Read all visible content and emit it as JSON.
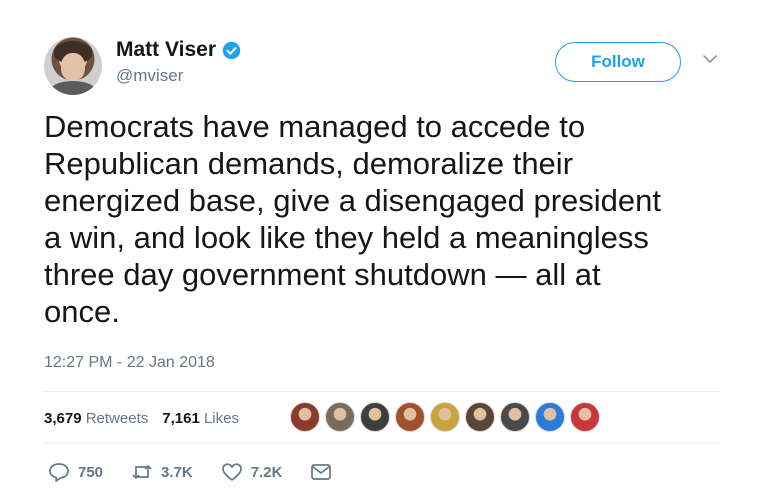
{
  "tweet": {
    "display_name": "Matt Viser",
    "handle": "@mviser",
    "follow_label": "Follow",
    "text": "Democrats have managed to accede to\nRepublican demands, demoralize their\nenergized base, give a disengaged president\na win, and look like they held a meaningless\nthree day government shutdown — all at\nonce.",
    "timestamp": "12:27 PM - 22 Jan 2018"
  },
  "stats": {
    "retweets_count": "3,679",
    "retweets_label": "Retweets",
    "likes_count": "7,161",
    "likes_label": "Likes"
  },
  "likers": [
    {
      "name": "liker-avatar-1",
      "color": "#8a3b2e"
    },
    {
      "name": "liker-avatar-2",
      "color": "#7a6a5a"
    },
    {
      "name": "liker-avatar-3",
      "color": "#3e3e3e"
    },
    {
      "name": "liker-avatar-4",
      "color": "#a0522d"
    },
    {
      "name": "liker-avatar-5",
      "color": "#c9a43a"
    },
    {
      "name": "liker-avatar-6",
      "color": "#5a4636"
    },
    {
      "name": "liker-avatar-7",
      "color": "#4a4a4a"
    },
    {
      "name": "liker-avatar-8",
      "color": "#2c7bd6"
    },
    {
      "name": "liker-avatar-9",
      "color": "#c8373b"
    }
  ],
  "actions": {
    "reply_count": "750",
    "retweet_count": "3.7K",
    "like_count": "7.2K"
  },
  "colors": {
    "accent": "#1da1f2",
    "text": "#14171a",
    "secondary_text": "#657786",
    "divider": "#e6ecf0"
  },
  "icons": [
    "verified-icon",
    "chevron-down-icon",
    "reply-icon",
    "retweet-icon",
    "like-icon",
    "direct-message-icon"
  ]
}
